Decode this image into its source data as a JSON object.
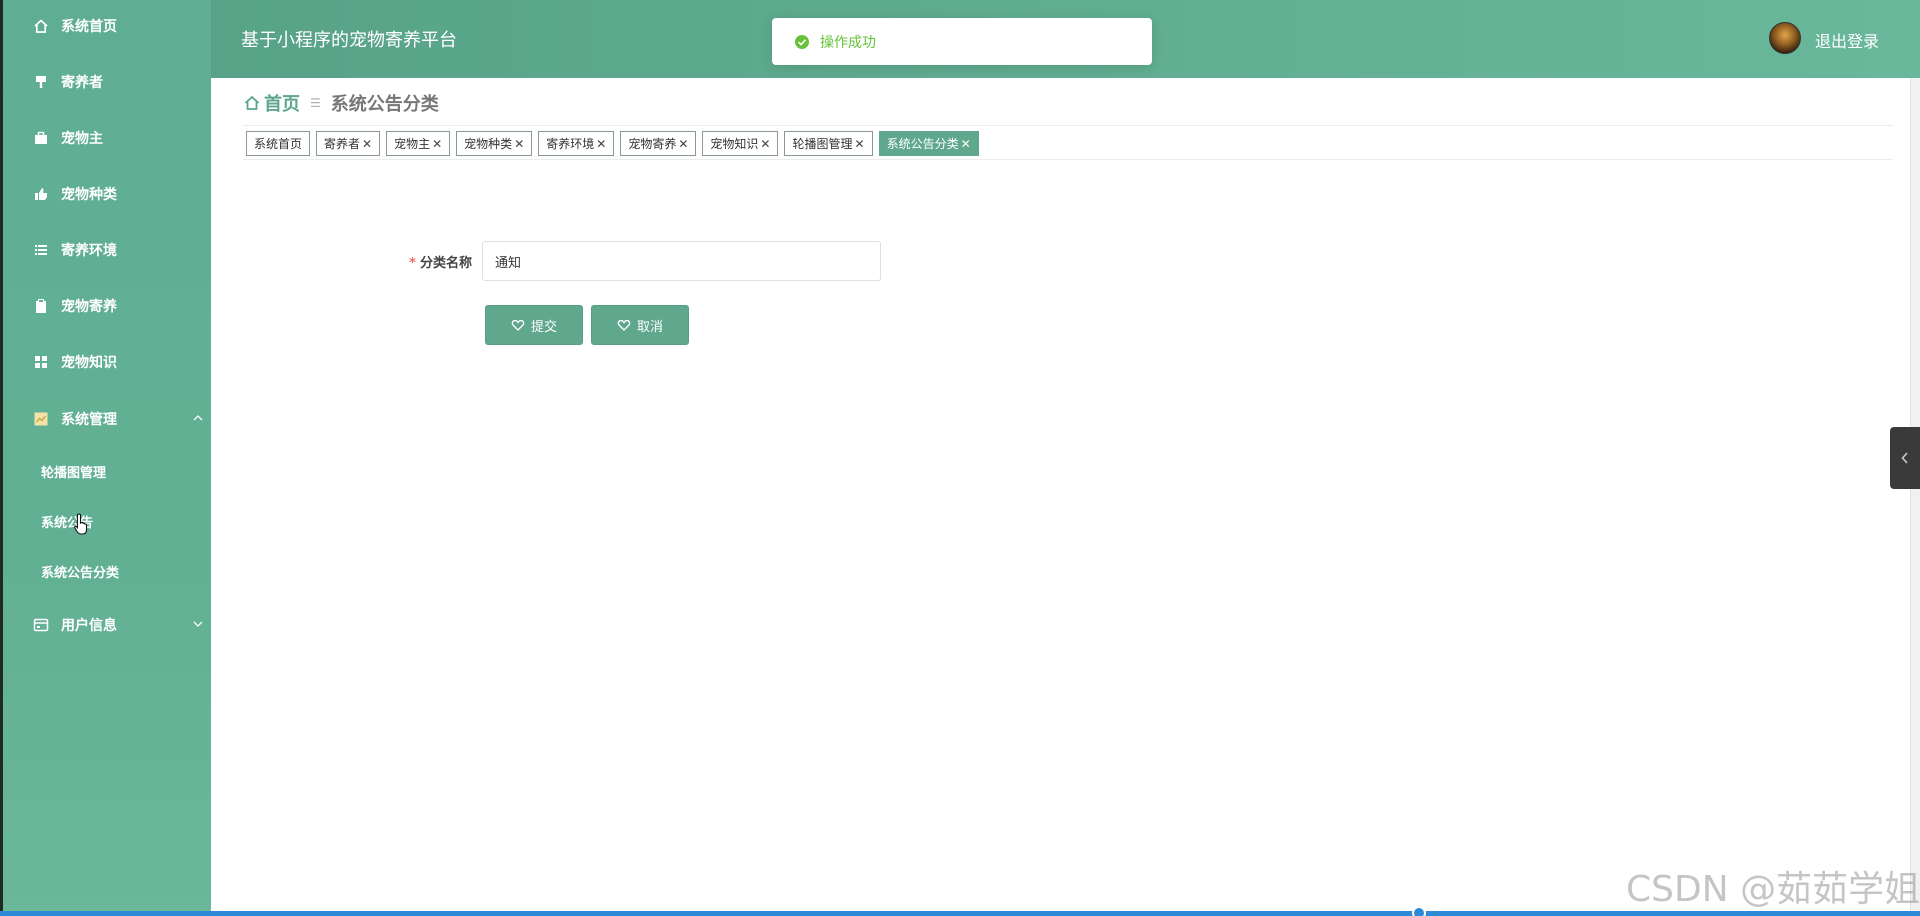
{
  "header": {
    "title": "基于小程序的宠物寄养平台",
    "logout_label": "退出登录"
  },
  "toast": {
    "message": "操作成功"
  },
  "sidebar": {
    "items": [
      {
        "label": "系统首页",
        "icon": "home-icon"
      },
      {
        "label": "寄养者",
        "icon": "pin-icon"
      },
      {
        "label": "宠物主",
        "icon": "briefcase-icon"
      },
      {
        "label": "宠物种类",
        "icon": "thumb-up-icon"
      },
      {
        "label": "寄养环境",
        "icon": "list-icon"
      },
      {
        "label": "宠物寄养",
        "icon": "clipboard-icon"
      },
      {
        "label": "宠物知识",
        "icon": "grid-icon"
      },
      {
        "label": "系统管理",
        "icon": "chart-icon",
        "expanded": true
      },
      {
        "label": "用户信息",
        "icon": "card-icon",
        "expanded": false
      }
    ],
    "sub_items": [
      {
        "label": "轮播图管理"
      },
      {
        "label": "系统公告"
      },
      {
        "label": "系统公告分类"
      }
    ]
  },
  "breadcrumb": {
    "home": "首页",
    "current": "系统公告分类"
  },
  "tags": [
    {
      "label": "系统首页",
      "closable": false,
      "active": false
    },
    {
      "label": "寄养者",
      "closable": true,
      "active": false
    },
    {
      "label": "宠物主",
      "closable": true,
      "active": false
    },
    {
      "label": "宠物种类",
      "closable": true,
      "active": false
    },
    {
      "label": "寄养环境",
      "closable": true,
      "active": false
    },
    {
      "label": "宠物寄养",
      "closable": true,
      "active": false
    },
    {
      "label": "宠物知识",
      "closable": true,
      "active": false
    },
    {
      "label": "轮播图管理",
      "closable": true,
      "active": false
    },
    {
      "label": "系统公告分类",
      "closable": true,
      "active": true
    }
  ],
  "form": {
    "required_mark": "*",
    "field_label": "分类名称",
    "field_value": "通知",
    "submit_label": "提交",
    "cancel_label": "取消"
  },
  "watermark": "CSDN @茹茹学姐",
  "colors": {
    "primary": "#5fa88e",
    "success": "#67c23a",
    "required": "#f56c6c"
  }
}
